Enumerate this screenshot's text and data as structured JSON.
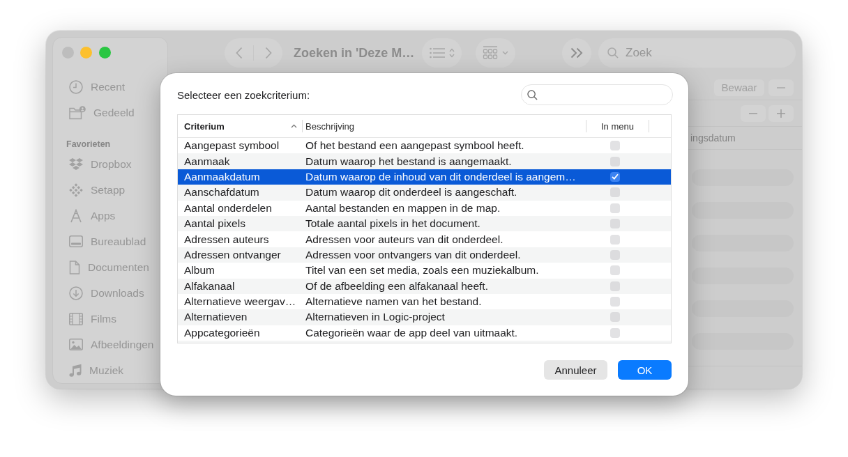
{
  "finder_window": {
    "title": "Zoeken in 'Deze M…",
    "search": {
      "placeholder": "Zoek"
    },
    "sidebar": {
      "items": [
        {
          "label": "Recent"
        },
        {
          "label": "Gedeeld"
        }
      ],
      "sections": [
        {
          "title": "Favorieten",
          "items": [
            {
              "label": "Dropbox"
            },
            {
              "label": "Setapp"
            },
            {
              "label": "Apps"
            },
            {
              "label": "Bureaublad"
            },
            {
              "label": "Documenten"
            },
            {
              "label": "Downloads"
            },
            {
              "label": "Films"
            },
            {
              "label": "Afbeeldingen"
            },
            {
              "label": "Muziek"
            }
          ]
        }
      ]
    },
    "save_button": "Bewaar",
    "column_header": "ingsdatum"
  },
  "dialog": {
    "prompt": "Selecteer een zoekcriterium:",
    "table": {
      "columns": [
        {
          "label": "Criterium",
          "sorted": true
        },
        {
          "label": "Beschrijving",
          "sorted": false
        },
        {
          "label": "In menu",
          "sorted": false
        }
      ],
      "rows": [
        {
          "criterion": "Aangepast symbool",
          "description": "Of het bestand een aangepast symbool heeft.",
          "in_menu": false,
          "selected": false
        },
        {
          "criterion": "Aanmaak",
          "description": "Datum waarop het bestand is aangemaakt.",
          "in_menu": false,
          "selected": false
        },
        {
          "criterion": "Aanmaakdatum",
          "description": "Datum waarop de inhoud van dit onderdeel is aangem…",
          "in_menu": true,
          "selected": true
        },
        {
          "criterion": "Aanschafdatum",
          "description": "Datum waarop dit onderdeel is aangeschaft.",
          "in_menu": false,
          "selected": false
        },
        {
          "criterion": "Aantal onderdelen",
          "description": "Aantal bestanden en mappen in de map.",
          "in_menu": false,
          "selected": false
        },
        {
          "criterion": "Aantal pixels",
          "description": "Totale aantal pixels in het document.",
          "in_menu": false,
          "selected": false
        },
        {
          "criterion": "Adressen auteurs",
          "description": "Adressen voor auteurs van dit onderdeel.",
          "in_menu": false,
          "selected": false
        },
        {
          "criterion": "Adressen ontvanger",
          "description": "Adressen voor ontvangers van dit onderdeel.",
          "in_menu": false,
          "selected": false
        },
        {
          "criterion": "Album",
          "description": "Titel van een set media, zoals een muziekalbum.",
          "in_menu": false,
          "selected": false
        },
        {
          "criterion": "Alfakanaal",
          "description": "Of de afbeelding een alfakanaal heeft.",
          "in_menu": false,
          "selected": false
        },
        {
          "criterion": "Alternatieve weergav…",
          "description": "Alternatieve namen van het bestand.",
          "in_menu": false,
          "selected": false
        },
        {
          "criterion": "Alternatieven",
          "description": "Alternatieven in Logic-project",
          "in_menu": false,
          "selected": false
        },
        {
          "criterion": "Appcategorieën",
          "description": "Categorieën waar de app deel van uitmaakt.",
          "in_menu": false,
          "selected": false
        }
      ]
    },
    "buttons": [
      {
        "label": "Annuleer",
        "kind": "cancel"
      },
      {
        "label": "OK",
        "kind": "default"
      }
    ]
  }
}
